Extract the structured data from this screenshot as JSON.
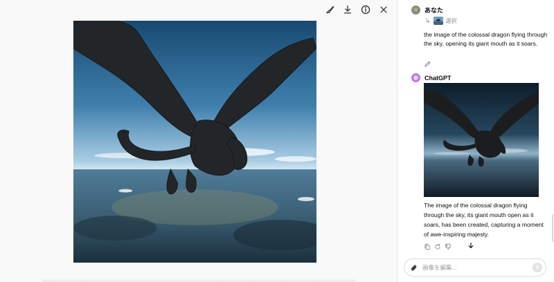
{
  "toolbar": {
    "icons": [
      "edit-image-icon",
      "download-icon",
      "info-icon",
      "close-icon"
    ]
  },
  "viewer": {
    "image_subject": "dragon-in-sky"
  },
  "conversation": {
    "user": {
      "author": "あなた",
      "avatar_initials": "U",
      "attachment_label": "選択",
      "text": "the image of the colossal dragon flying through the sky, opening its giant mouth as it soars."
    },
    "assistant": {
      "author": "ChatGPT",
      "text": "The image of the colossal dragon flying through the sky, its giant mouth open as it soars, has been created, capturing a moment of awe-inspiring majesty.",
      "action_icons": [
        "copy-icon",
        "regenerate-icon",
        "thumbs-down-icon"
      ]
    }
  },
  "composer": {
    "placeholder": "画像を編集..."
  },
  "colors": {
    "viewer_background": "#f9f9f9",
    "user_avatar": "#8a8f78",
    "assistant_avatar": "#b57bf0",
    "sky_top": "#1f5a85",
    "sky_horizon": "#a9cde3",
    "dragon": "#232628"
  }
}
